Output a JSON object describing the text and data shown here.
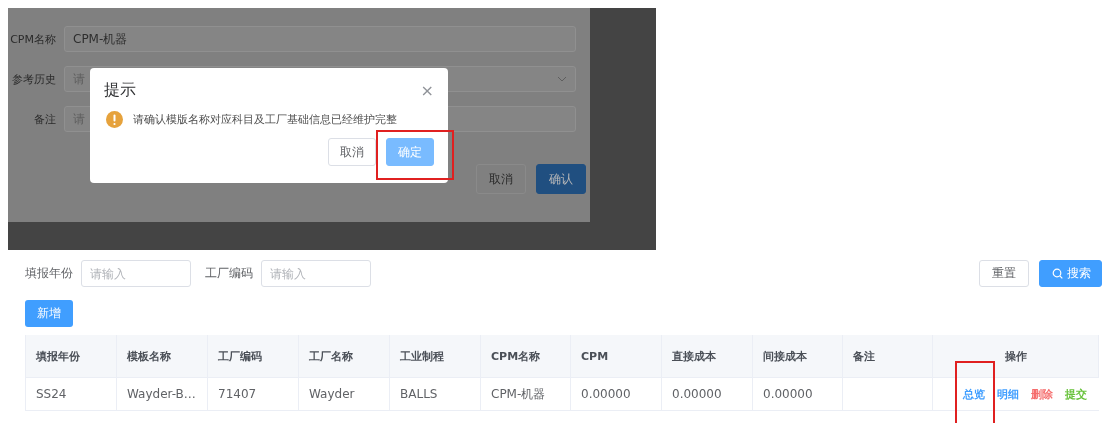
{
  "background_form": {
    "fields": [
      {
        "label": "CPM名称",
        "kind": "text",
        "value": "CPM-机器"
      },
      {
        "label": "参考历史",
        "kind": "select",
        "placeholder": "请"
      },
      {
        "label": "备注",
        "kind": "text",
        "placeholder": "请"
      }
    ],
    "buttons": [
      {
        "label": "取消",
        "kind": "default"
      },
      {
        "label": "确认",
        "kind": "primary"
      }
    ]
  },
  "dialog": {
    "title": "提示",
    "close": "×",
    "message": "请确认模版名称对应科目及工厂基础信息已经维护完整",
    "buttons": [
      {
        "label": "取消",
        "kind": "default",
        "highlighted": false
      },
      {
        "label": "确定",
        "kind": "primary",
        "highlighted": true
      }
    ]
  },
  "search": {
    "fields": [
      {
        "label": "填报年份",
        "placeholder": "请输入"
      },
      {
        "label": "工厂编码",
        "placeholder": "请输入"
      }
    ],
    "buttons": [
      {
        "label": "重置",
        "kind": "default"
      },
      {
        "label": "搜索",
        "kind": "search"
      }
    ]
  },
  "add_button": "新增",
  "table": {
    "columns": [
      "填报年份",
      "模板名称",
      "工厂编码",
      "工厂名称",
      "工业制程",
      "CPM名称",
      "CPM",
      "直接成本",
      "间接成本",
      "备注",
      "操作"
    ],
    "rows": [
      {
        "cells": [
          "SS24",
          "Wayder-B…",
          "71407",
          "Wayder",
          "BALLS",
          "CPM-机器",
          "0.00000",
          "0.00000",
          "0.00000",
          ""
        ],
        "actions": [
          {
            "label": "总览",
            "color": "#409eff",
            "highlighted": true
          },
          {
            "label": "明细",
            "color": "#409eff",
            "highlighted": false
          },
          {
            "label": "删除",
            "color": "#f56c6c",
            "highlighted": false
          },
          {
            "label": "提交",
            "color": "#67c23a",
            "highlighted": false
          }
        ]
      }
    ]
  }
}
